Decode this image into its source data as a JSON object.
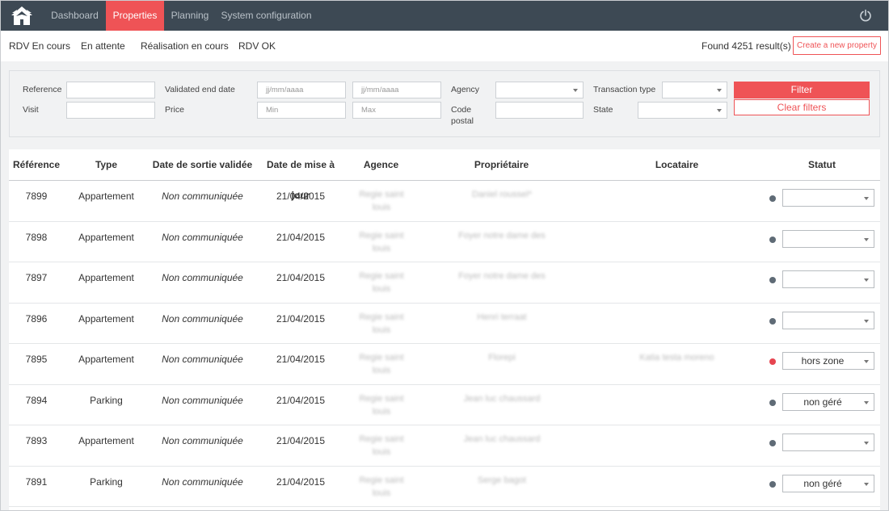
{
  "nav": {
    "items": [
      {
        "label": "Dashboard",
        "active": false
      },
      {
        "label": "Properties",
        "active": true
      },
      {
        "label": "Planning",
        "active": false
      },
      {
        "label": "System configuration",
        "active": false
      }
    ],
    "logo_icon": "house-logo-icon",
    "power_icon": "power-icon"
  },
  "subnav": {
    "items": [
      "RDV En cours",
      "En attente",
      "Réalisation en cours",
      "RDV OK"
    ],
    "found_text": "Found 4251 result(s)",
    "create_label": "Create a new property"
  },
  "filters": {
    "reference_label": "Reference",
    "visit_label": "Visit",
    "validated_end_date_label": "Validated end date",
    "price_label": "Price",
    "date_from_placeholder": "jj/mm/aaaa",
    "date_to_placeholder": "jj/mm/aaaa",
    "price_min_placeholder": "Min",
    "price_max_placeholder": "Max",
    "agency_label": "Agency",
    "code_postal_label": "Code postal",
    "transaction_type_label": "Transaction type",
    "state_label": "State",
    "filter_label": "Filter",
    "clear_label": "Clear filters"
  },
  "table": {
    "headers": {
      "reference": "Référence",
      "type": "Type",
      "date_sortie": "Date de sortie validée",
      "date_maj": "Date de mise à jour",
      "agence": "Agence",
      "proprietaire": "Propriétaire",
      "locataire": "Locataire",
      "statut": "Statut"
    },
    "rows": [
      {
        "reference": "7899",
        "type": "Appartement",
        "date_sortie": "Non communiquée",
        "date_maj": "21/04/2015",
        "agence": "Regie saint louis",
        "proprietaire": "Daniel roussel*",
        "locataire": "",
        "statut": "",
        "dot_color": "#5f6b76"
      },
      {
        "reference": "7898",
        "type": "Appartement",
        "date_sortie": "Non communiquée",
        "date_maj": "21/04/2015",
        "agence": "Regie saint louis",
        "proprietaire": "Foyer notre dame des",
        "locataire": "",
        "statut": "",
        "dot_color": "#5f6b76"
      },
      {
        "reference": "7897",
        "type": "Appartement",
        "date_sortie": "Non communiquée",
        "date_maj": "21/04/2015",
        "agence": "Regie saint louis",
        "proprietaire": "Foyer notre dame des",
        "locataire": "",
        "statut": "",
        "dot_color": "#5f6b76"
      },
      {
        "reference": "7896",
        "type": "Appartement",
        "date_sortie": "Non communiquée",
        "date_maj": "21/04/2015",
        "agence": "Regie saint louis",
        "proprietaire": "Henri terraat",
        "locataire": "",
        "statut": "",
        "dot_color": "#5f6b76"
      },
      {
        "reference": "7895",
        "type": "Appartement",
        "date_sortie": "Non communiquée",
        "date_maj": "21/04/2015",
        "agence": "Regie saint louis",
        "proprietaire": "Florepi",
        "locataire": "Katia testa moreno",
        "statut": "hors zone",
        "dot_color": "#e64550"
      },
      {
        "reference": "7894",
        "type": "Parking",
        "date_sortie": "Non communiquée",
        "date_maj": "21/04/2015",
        "agence": "Regie saint louis",
        "proprietaire": "Jean luc chaussard",
        "locataire": "",
        "statut": "non géré",
        "dot_color": "#5f6b76"
      },
      {
        "reference": "7893",
        "type": "Appartement",
        "date_sortie": "Non communiquée",
        "date_maj": "21/04/2015",
        "agence": "Regie saint louis",
        "proprietaire": "Jean luc chaussard",
        "locataire": "",
        "statut": "",
        "dot_color": "#5f6b76"
      },
      {
        "reference": "7891",
        "type": "Parking",
        "date_sortie": "Non communiquée",
        "date_maj": "21/04/2015",
        "agence": "Regie saint louis",
        "proprietaire": "Serge bagot",
        "locataire": "",
        "statut": "non géré",
        "dot_color": "#5f6b76"
      }
    ]
  },
  "colors": {
    "nav_bg": "#3d4954",
    "accent": "#ef5356",
    "status_dot_default": "#5f6b76",
    "status_dot_alert": "#e64550"
  }
}
